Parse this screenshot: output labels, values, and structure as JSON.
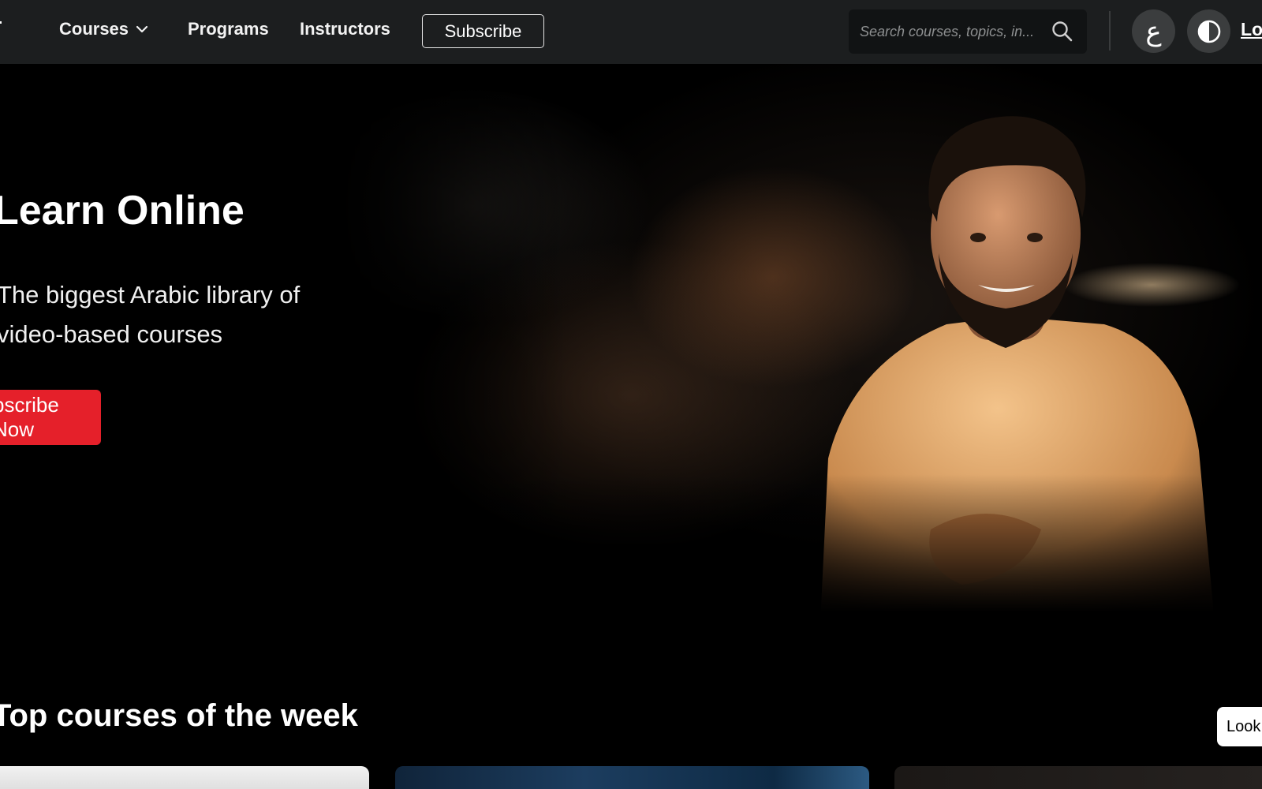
{
  "navbar": {
    "courses_label": "Courses",
    "programs_label": "Programs",
    "instructors_label": "Instructors",
    "subscribe_label": "Subscribe",
    "search_placeholder": "Search courses, topics, in...",
    "lang_label": "ع",
    "login_label": "Login"
  },
  "hero": {
    "title": "Learn Online",
    "subtitle": "The biggest Arabic library of video-based courses",
    "cta_label": "Subscribe Now"
  },
  "section": {
    "title": "Top courses of the week",
    "chip_label": "Look"
  },
  "colors": {
    "navbar_bg": "#1c1e1f",
    "accent_red": "#e5202a",
    "page_bg": "#000000"
  },
  "icons": {
    "search": "search-icon",
    "language": "arabic-letter-icon",
    "theme": "contrast-icon",
    "chevron": "chevron-down-icon"
  }
}
